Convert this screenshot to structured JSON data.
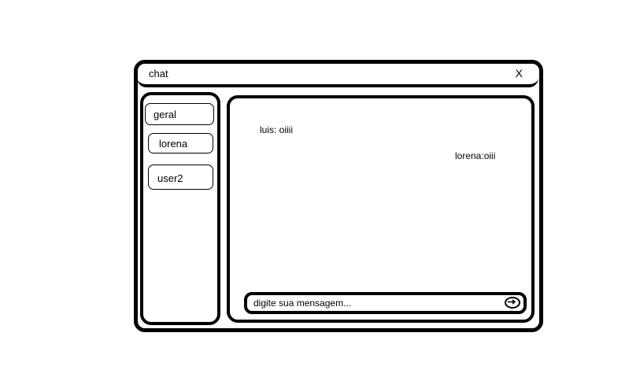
{
  "window": {
    "title": "chat",
    "close_label": "X"
  },
  "sidebar": {
    "items": [
      {
        "label": "geral"
      },
      {
        "label": "lorena"
      },
      {
        "label": "user2"
      }
    ]
  },
  "chat": {
    "messages": [
      {
        "text": "luis: oiiii",
        "side": "left"
      },
      {
        "text": "lorena:oiii",
        "side": "right"
      }
    ]
  },
  "composer": {
    "placeholder": "digite sua mensagem...",
    "value": "",
    "send_icon": "send-icon"
  }
}
